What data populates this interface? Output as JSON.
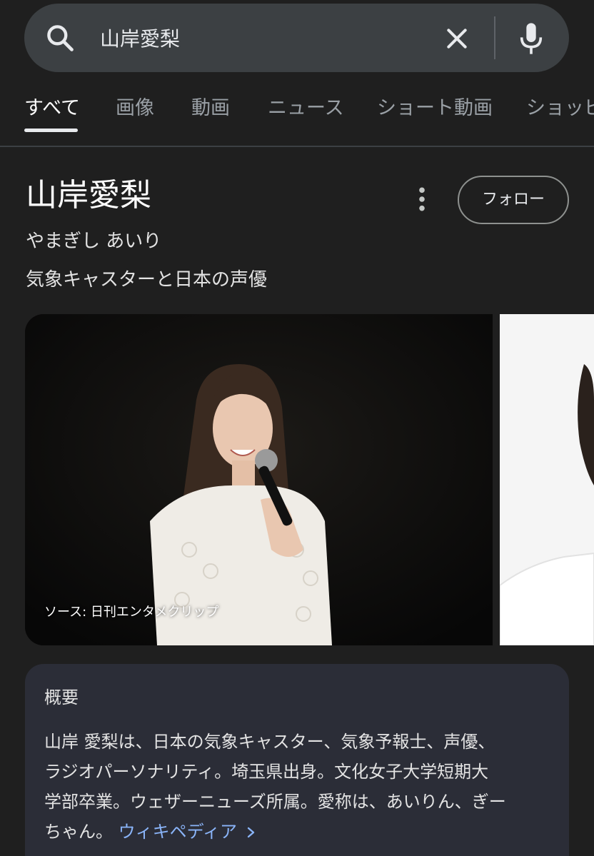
{
  "search": {
    "query": "山岸愛梨"
  },
  "tabs": [
    {
      "label": "すべて",
      "active": true
    },
    {
      "label": "画像",
      "active": false
    },
    {
      "label": "動画",
      "active": false
    },
    {
      "label": "ニュース",
      "active": false
    },
    {
      "label": "ショート動画",
      "active": false
    },
    {
      "label": "ショッピ",
      "active": false
    }
  ],
  "knowledge_panel": {
    "title": "山岸愛梨",
    "reading": "やまぎし あいり",
    "subtitle": "気象キャスターと日本の声優",
    "follow_label": "フォロー",
    "image_caption": "ソース: 日刊エンタメクリップ"
  },
  "overview": {
    "title": "概要",
    "text_lines": [
      "山岸 愛梨は、日本の気象キャスター、気象予報士、声優、",
      "ラジオパーソナリティ。埼玉県出身。文化女子大学短期大",
      "学部卒業。ウェザーニューズ所属。愛称は、あいりん、ぎー",
      "ちゃん。"
    ],
    "link_label": "ウィキペディア"
  },
  "icons": {
    "search": "search-icon",
    "clear": "close-icon",
    "mic": "microphone-icon",
    "more": "more-vert-icon",
    "chevron": "chevron-right-icon"
  },
  "colors": {
    "background": "#1f1f1f",
    "search_bar": "#3c4043",
    "card": "#2b2d37",
    "link": "#8ab4f8"
  }
}
